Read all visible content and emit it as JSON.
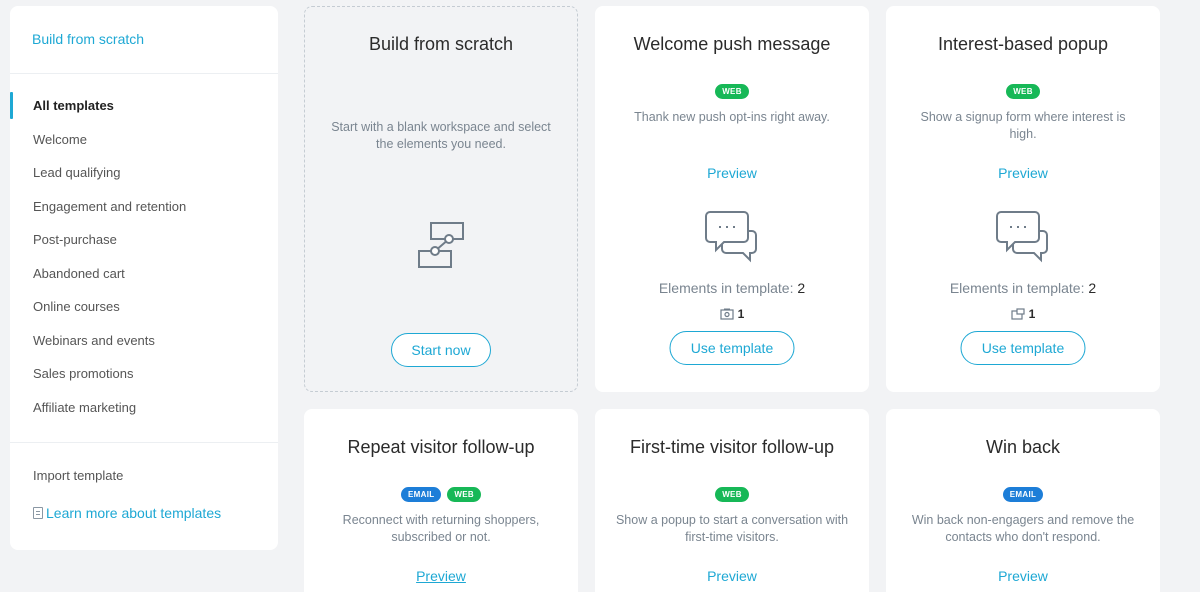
{
  "sidebar": {
    "top_link": "Build from scratch",
    "items": [
      {
        "label": "All templates"
      },
      {
        "label": "Welcome"
      },
      {
        "label": "Lead qualifying"
      },
      {
        "label": "Engagement and retention"
      },
      {
        "label": "Post-purchase"
      },
      {
        "label": "Abandoned cart"
      },
      {
        "label": "Online courses"
      },
      {
        "label": "Webinars and events"
      },
      {
        "label": "Sales promotions"
      },
      {
        "label": "Affiliate marketing"
      }
    ],
    "import_label": "Import template",
    "learn_label": "Learn more about templates"
  },
  "colors": {
    "accent": "#1ea8d4",
    "web_badge": "#17b857",
    "email_badge": "#1d7ed8"
  },
  "cards": [
    {
      "title": "Build from scratch",
      "description": "Start with a blank workspace and select the elements you need.",
      "button": "Start now",
      "icon": "workflow-icon"
    },
    {
      "title": "Welcome push message",
      "badges": [
        "WEB"
      ],
      "description": "Thank new push opt-ins right away.",
      "preview": "Preview",
      "elements_label": "Elements in template:",
      "elements_count": "2",
      "sub_count": "1",
      "sub_icon": "push-notification-icon",
      "button": "Use template",
      "icon": "chat-bubbles-icon"
    },
    {
      "title": "Interest-based popup",
      "badges": [
        "WEB"
      ],
      "description": "Show a signup form where interest is high.",
      "preview": "Preview",
      "elements_label": "Elements in template:",
      "elements_count": "2",
      "sub_count": "1",
      "sub_icon": "popup-icon",
      "button": "Use template",
      "icon": "chat-bubbles-icon"
    },
    {
      "title": "Repeat visitor follow-up",
      "badges": [
        "EMAIL",
        "WEB"
      ],
      "description": "Reconnect with returning shoppers, subscribed or not.",
      "preview": "Preview"
    },
    {
      "title": "First-time visitor follow-up",
      "badges": [
        "WEB"
      ],
      "description": "Show a popup to start a conversation with first-time visitors.",
      "preview": "Preview"
    },
    {
      "title": "Win back",
      "badges": [
        "EMAIL"
      ],
      "description": "Win back non-engagers and remove the contacts who don't respond.",
      "preview": "Preview"
    }
  ]
}
